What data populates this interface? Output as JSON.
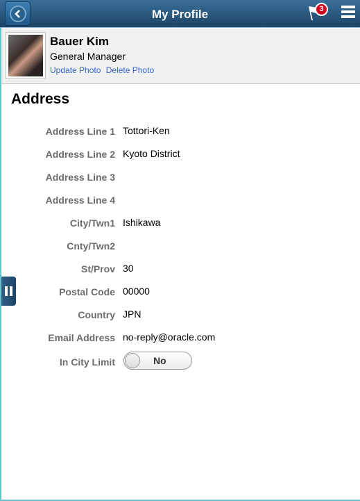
{
  "header": {
    "title": "My Profile",
    "notification_count": "3",
    "icons": {
      "back": "back-chevron-icon",
      "notifications": "flag-icon",
      "menu": "hamburger-menu-icon"
    }
  },
  "profile": {
    "name": "Bauer Kim",
    "job_title": "General Manager",
    "update_photo": "Update Photo",
    "delete_photo": "Delete Photo"
  },
  "section": {
    "title": "Address",
    "fields": [
      {
        "label": "Address Line 1",
        "value": "Tottori-Ken"
      },
      {
        "label": "Address Line 2",
        "value": "Kyoto District"
      },
      {
        "label": "Address Line 3",
        "value": ""
      },
      {
        "label": "Address Line 4",
        "value": ""
      },
      {
        "label": "City/Twn1",
        "value": "Ishikawa"
      },
      {
        "label": "Cnty/Twn2",
        "value": ""
      },
      {
        "label": "St/Prov",
        "value": "30"
      },
      {
        "label": "Postal Code",
        "value": "00000"
      },
      {
        "label": "Country",
        "value": "JPN"
      },
      {
        "label": "Email Address",
        "value": "no-reply@oracle.com"
      }
    ],
    "in_city_limit": {
      "label": "In City Limit",
      "value": "No"
    }
  },
  "colors": {
    "header": "#1d4465",
    "link": "#3a67c5",
    "badge": "#d0021b",
    "frame": "#6bbecb"
  }
}
